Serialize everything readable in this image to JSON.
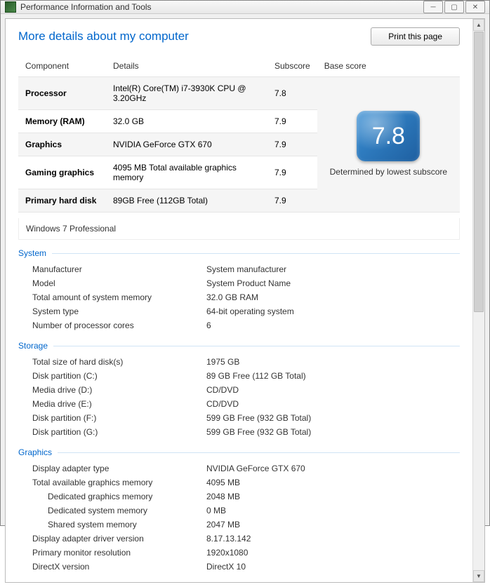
{
  "window": {
    "title": "Performance Information and Tools"
  },
  "header": {
    "page_title": "More details about my computer",
    "print_label": "Print this page"
  },
  "scores": {
    "cols": {
      "component": "Component",
      "details": "Details",
      "subscore": "Subscore",
      "base": "Base score"
    },
    "rows": [
      {
        "component": "Processor",
        "details": "Intel(R) Core(TM) i7-3930K CPU @ 3.20GHz",
        "subscore": "7.8"
      },
      {
        "component": "Memory (RAM)",
        "details": "32.0 GB",
        "subscore": "7.9"
      },
      {
        "component": "Graphics",
        "details": "NVIDIA GeForce GTX 670",
        "subscore": "7.9"
      },
      {
        "component": "Gaming graphics",
        "details": "4095 MB Total available graphics memory",
        "subscore": "7.9"
      },
      {
        "component": "Primary hard disk",
        "details": "89GB Free (112GB Total)",
        "subscore": "7.9"
      }
    ],
    "base_value": "7.8",
    "base_caption": "Determined by lowest subscore",
    "os": "Windows 7 Professional"
  },
  "sections": {
    "system": {
      "title": "System",
      "items": [
        {
          "k": "Manufacturer",
          "v": "System manufacturer"
        },
        {
          "k": "Model",
          "v": "System Product Name"
        },
        {
          "k": "Total amount of system memory",
          "v": "32.0 GB RAM"
        },
        {
          "k": "System type",
          "v": "64-bit operating system"
        },
        {
          "k": "Number of processor cores",
          "v": "6"
        }
      ]
    },
    "storage": {
      "title": "Storage",
      "items": [
        {
          "k": "Total size of hard disk(s)",
          "v": "1975 GB"
        },
        {
          "k": "Disk partition (C:)",
          "v": "89 GB Free (112 GB Total)"
        },
        {
          "k": "Media drive (D:)",
          "v": "CD/DVD"
        },
        {
          "k": "Media drive (E:)",
          "v": "CD/DVD"
        },
        {
          "k": "Disk partition (F:)",
          "v": "599 GB Free (932 GB Total)"
        },
        {
          "k": "Disk partition (G:)",
          "v": "599 GB Free (932 GB Total)"
        }
      ]
    },
    "graphics": {
      "title": "Graphics",
      "items": [
        {
          "k": "Display adapter type",
          "v": "NVIDIA GeForce GTX 670",
          "indent": 1
        },
        {
          "k": "Total available graphics memory",
          "v": "4095 MB",
          "indent": 1
        },
        {
          "k": "Dedicated graphics memory",
          "v": "2048 MB",
          "indent": 2
        },
        {
          "k": "Dedicated system memory",
          "v": "0 MB",
          "indent": 2
        },
        {
          "k": "Shared system memory",
          "v": "2047 MB",
          "indent": 2
        },
        {
          "k": "Display adapter driver version",
          "v": "8.17.13.142",
          "indent": 1
        },
        {
          "k": "Primary monitor resolution",
          "v": "1920x1080",
          "indent": 1
        },
        {
          "k": "DirectX version",
          "v": "DirectX 10",
          "indent": 1
        }
      ]
    }
  }
}
